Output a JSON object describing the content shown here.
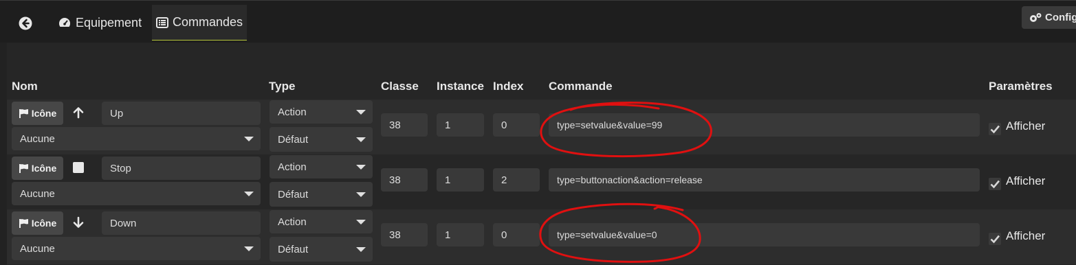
{
  "tabs": {
    "equipement": "Equipement",
    "commandes": "Commandes"
  },
  "config_button": "Configu",
  "headers": {
    "nom": "Nom",
    "type": "Type",
    "classe": "Classe",
    "instance": "Instance",
    "index": "Index",
    "commande": "Commande",
    "parametres": "Paramètres"
  },
  "rows": [
    {
      "icon_label": "Icône",
      "glyph": "arrow-up-icon",
      "name": "Up",
      "icon_choice": "Aucune",
      "type": "Action",
      "subtype": "Défaut",
      "classe": "38",
      "instance": "1",
      "index": "0",
      "commande": "type=setvalue&value=99",
      "afficher": "Afficher"
    },
    {
      "icon_label": "Icône",
      "glyph": "stop-square-icon",
      "name": "Stop",
      "icon_choice": "Aucune",
      "type": "Action",
      "subtype": "Défaut",
      "classe": "38",
      "instance": "1",
      "index": "2",
      "commande": "type=buttonaction&action=release",
      "afficher": "Afficher"
    },
    {
      "icon_label": "Icône",
      "glyph": "arrow-down-icon",
      "name": "Down",
      "icon_choice": "Aucune",
      "type": "Action",
      "subtype": "Défaut",
      "classe": "38",
      "instance": "1",
      "index": "0",
      "commande": "type=setvalue&value=0",
      "afficher": "Afficher"
    }
  ],
  "colors": {
    "accent_underline": "#b7c63a",
    "annotation": "#e01010"
  }
}
